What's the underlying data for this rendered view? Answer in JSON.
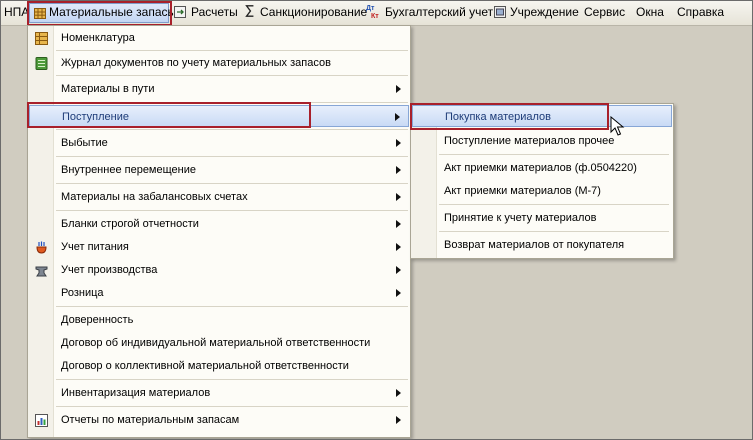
{
  "menubar": {
    "items": [
      {
        "label": "НПА"
      },
      {
        "label": "Материальные запасы"
      },
      {
        "label": "Расчеты"
      },
      {
        "label": "Санкционирование"
      },
      {
        "label": "Бухгалтерский учет"
      },
      {
        "label": "Учреждение"
      },
      {
        "label": "Сервис"
      },
      {
        "label": "Окна"
      },
      {
        "label": "Справка"
      }
    ]
  },
  "main_menu": {
    "items": [
      {
        "label": "Номенклатура"
      },
      {
        "label": "Журнал документов по учету материальных запасов"
      },
      {
        "label": "Материалы в пути"
      },
      {
        "label": "Поступление"
      },
      {
        "label": "Выбытие"
      },
      {
        "label": "Внутреннее перемещение"
      },
      {
        "label": "Материалы на забалансовых счетах"
      },
      {
        "label": "Бланки строгой отчетности"
      },
      {
        "label": "Учет питания"
      },
      {
        "label": "Учет производства"
      },
      {
        "label": "Розница"
      },
      {
        "label": "Доверенность"
      },
      {
        "label": "Договор об индивидуальной материальной ответственности"
      },
      {
        "label": "Договор о коллективной материальной ответственности"
      },
      {
        "label": "Инвентаризация материалов"
      },
      {
        "label": "Отчеты по материальным запасам"
      }
    ]
  },
  "submenu": {
    "items": [
      {
        "label": "Покупка материалов"
      },
      {
        "label": "Поступление материалов прочее"
      },
      {
        "label": "Акт приемки материалов (ф.0504220)"
      },
      {
        "label": "Акт приемки материалов (М-7)"
      },
      {
        "label": "Принятие к учету материалов"
      },
      {
        "label": "Возврат материалов от покупателя"
      }
    ]
  },
  "icons": {
    "materials": "warehouse-icon",
    "calc": "calc-icon",
    "sanction": "sigma-icon",
    "accounting": "dt-kt-icon",
    "catalog": "catalog-icon",
    "journal": "journal-icon",
    "food": "food-icon",
    "production": "anvil-icon",
    "reports": "report-icon"
  }
}
